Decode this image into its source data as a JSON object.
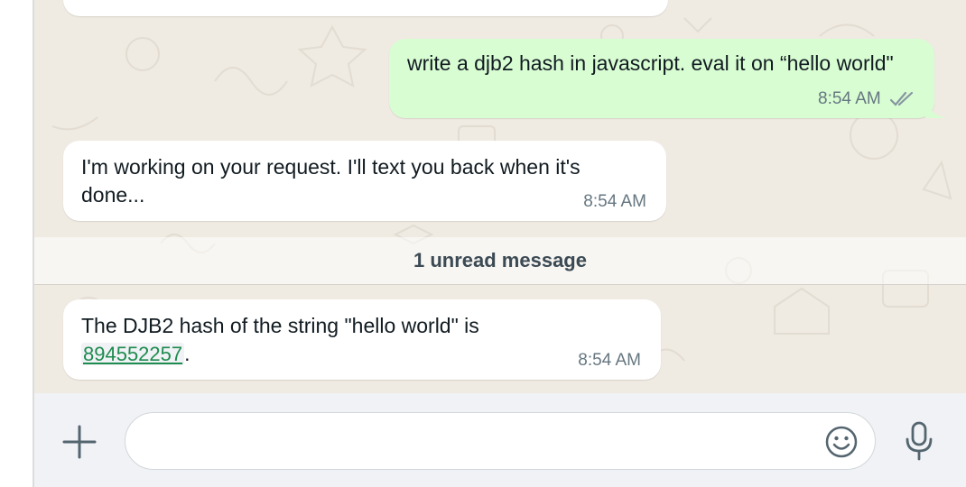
{
  "messages": [
    {
      "direction": "in",
      "text": "",
      "time": ""
    },
    {
      "direction": "out",
      "text": "write a djb2 hash in javascript. eval it on “hello world\"",
      "time": "8:54 AM",
      "status_icon": "double-check-icon"
    },
    {
      "direction": "in",
      "text": "I'm working on your request. I'll text you back when it's done...",
      "time": "8:54 AM"
    },
    {
      "direction": "in",
      "text_prefix": "The DJB2 hash of the string \"hello world\" is ",
      "hash_value": "894552257",
      "text_suffix": ".",
      "time": "8:54 AM"
    }
  ],
  "unread_banner": "1 unread message",
  "composer": {
    "placeholder": "",
    "attach_icon": "plus-icon",
    "emoji_icon": "smiley-icon",
    "mic_icon": "microphone-icon"
  },
  "colors": {
    "chat_background": "#efeae2",
    "outgoing_bubble": "#d9fdd3",
    "incoming_bubble": "#ffffff",
    "link_color": "#1e8b4f",
    "timestamp": "#667781",
    "composer_bar": "#f0f2f5"
  }
}
